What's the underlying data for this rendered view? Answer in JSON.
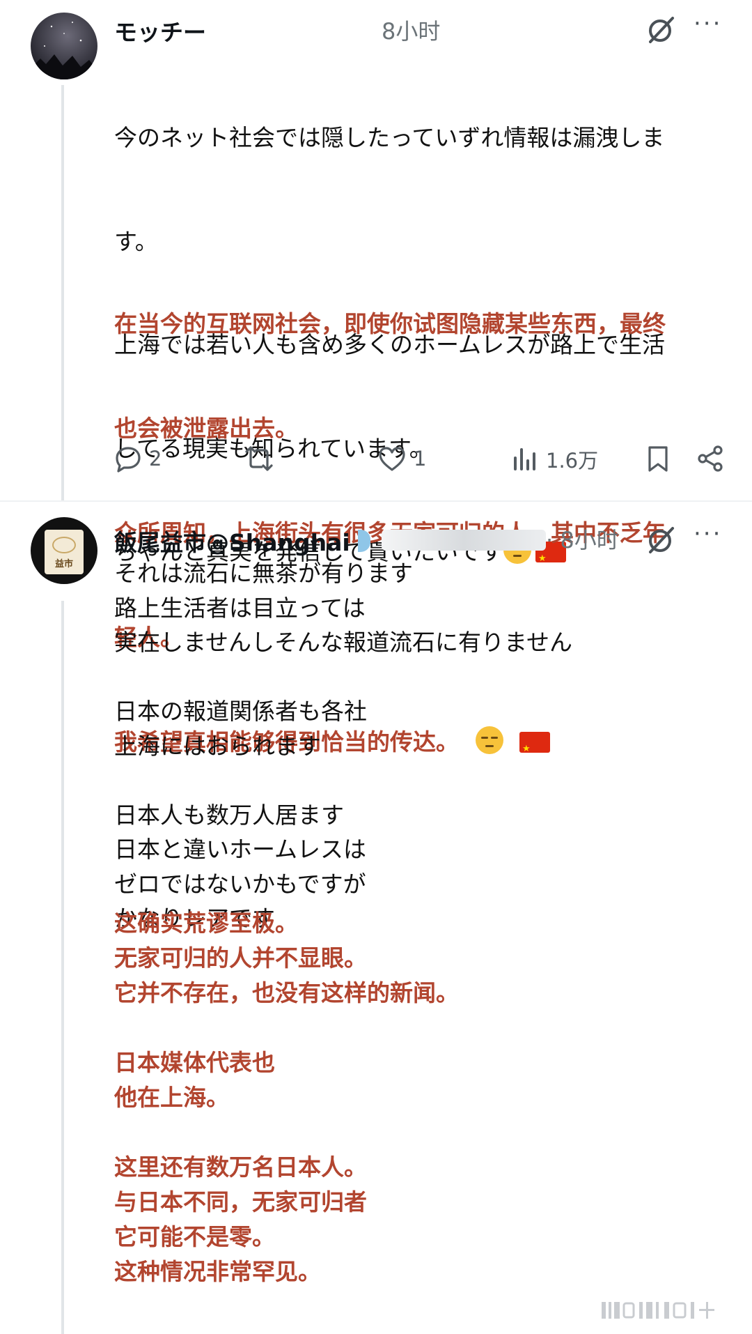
{
  "post1": {
    "name": "モッチー",
    "time": "8小时",
    "text_jp_lines": [
      "今のネット社会では隠したっていずれ情報は漏洩しま",
      "す。",
      "上海では若い人も含め多くのホームレスが路上で生活",
      "してる現実も知られています。",
      "ちゃんと真実を発信して貰いたいです"
    ],
    "text_cn_lines": [
      "在当今的互联网社会，即使你试图隐藏某些东西，最终",
      "也会被泄露出去。",
      "众所周知，上海街头有很多无家可归的人，其中不乏年",
      "轻人。",
      "我希望真相能够得到恰当的传达。"
    ],
    "actions": {
      "replies": "2",
      "retweets": "",
      "likes": "1",
      "views": "1.6万"
    }
  },
  "post2": {
    "name": "飯尾益市@Shanghai",
    "handle_time": "· 8小时",
    "avatar_text": "益市",
    "text_jp": "それは流石に無茶が有ります\n路上生活者は目立っては\n実在しませんしそんな報道流石に有りません\n\n日本の報道関係者も各社\n上海にはおられます\n\n日本人も数万人居ます\n日本と違いホームレスは\nゼロではないかもですが\nかなりレアです",
    "text_cn": "这确实荒谬至极。\n无家可归的人并不显眼。\n它并不存在，也没有这样的新闻。\n\n日本媒体代表也\n他在上海。\n\n这里还有数万名日本人。\n与日本不同，无家可归者\n它可能不是零。\n这种情况非常罕见。"
  },
  "icons": [
    "grok-icon",
    "more-icon",
    "reply-icon",
    "retweet-icon",
    "like-icon",
    "views-icon",
    "bookmark-icon",
    "share-icon"
  ],
  "colors": {
    "translation_text": "#b2452f",
    "meta_text": "#6b7378",
    "thread_line": "#e1e5e8"
  }
}
